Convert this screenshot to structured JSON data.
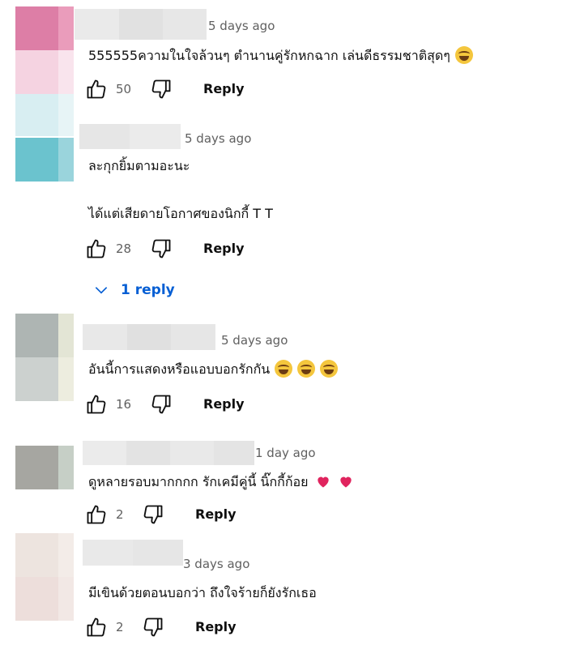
{
  "icons": {
    "like": "thumbs-up-icon",
    "dislike": "thumbs-down-icon",
    "expand": "chevron-down-icon",
    "laugh": "tears-of-joy-emoji",
    "heart": "red-heart-emoji"
  },
  "colors": {
    "link": "#065fd4",
    "muted": "#606060",
    "text": "#0f0f0f",
    "heart": "#e0245e"
  },
  "comments": [
    {
      "time": "5 days ago",
      "lines": [
        "555555ความในใจล้วนๆ ตำนานคู่รักหกฉาก เล่นดีธรรมชาติสุดๆ"
      ],
      "likes": "50",
      "reply_label": "Reply"
    },
    {
      "time": "5 days ago",
      "lines": [
        "ละกุกยิ้มตามอะนะ",
        "ได้แต่เสียดายโอกาศของนิกกี้ T T"
      ],
      "likes": "28",
      "reply_label": "Reply",
      "replies_label": "1 reply"
    },
    {
      "time": "5 days ago",
      "lines": [
        "อันนี้การแสดงหรือแอบบอกรักกัน"
      ],
      "likes": "16",
      "reply_label": "Reply"
    },
    {
      "time": "1 day ago",
      "lines": [
        "ดูหลายรอบมากกกก รักเคมีคู่นี้ นิ๊กกี้ก้อย"
      ],
      "likes": "2",
      "reply_label": "Reply"
    },
    {
      "time": "3 days ago",
      "lines": [
        "มีเขินด้วยตอนบอกว่า ถึงใจร้ายก็ยังรักเธอ"
      ],
      "likes": "2",
      "reply_label": "Reply"
    }
  ]
}
